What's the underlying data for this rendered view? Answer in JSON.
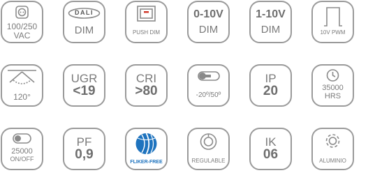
{
  "tiles": [
    {
      "id": "power",
      "icon": "power-socket-icon",
      "lines": [
        "100/250",
        "VAC"
      ]
    },
    {
      "id": "dali",
      "icon": "dali-icon",
      "logo": "DALI",
      "lines": [
        "DIM"
      ]
    },
    {
      "id": "push",
      "icon": "push-switch-icon",
      "lines": [
        "PUSH DIM"
      ]
    },
    {
      "id": "v010",
      "lines": [
        "0-10V",
        "DIM"
      ]
    },
    {
      "id": "v110",
      "lines": [
        "1-10V",
        "DIM"
      ]
    },
    {
      "id": "pwm",
      "icon": "pwm-wave-icon",
      "lines": [
        "10V PWM"
      ]
    },
    {
      "id": "beam",
      "icon": "beam-angle-icon",
      "lines": [
        "120°"
      ]
    },
    {
      "id": "ugr",
      "lines": [
        "UGR",
        "<19"
      ]
    },
    {
      "id": "cri",
      "lines": [
        "CRI",
        ">80"
      ]
    },
    {
      "id": "temp",
      "icon": "thermometer-icon",
      "lines": [
        "-20º/50º"
      ]
    },
    {
      "id": "ip",
      "lines": [
        "IP",
        "20"
      ]
    },
    {
      "id": "hrs",
      "icon": "clock-icon",
      "lines": [
        "35000",
        "HRS"
      ]
    },
    {
      "id": "onoff",
      "icon": "toggle-switch-icon",
      "lines": [
        "25000",
        "ON/OFF"
      ]
    },
    {
      "id": "pf",
      "lines": [
        "PF",
        "0,9"
      ]
    },
    {
      "id": "flicker",
      "icon": "flicker-free-globe-icon",
      "lines": [
        "FLIKER-FREE"
      ],
      "accent": "#1e73be"
    },
    {
      "id": "dim",
      "icon": "dimmer-knob-icon",
      "lines": [
        "REGULABLE"
      ]
    },
    {
      "id": "ik",
      "lines": [
        "IK",
        "06"
      ]
    },
    {
      "id": "alu",
      "icon": "gear-icon",
      "lines": [
        "ALUMINIO"
      ]
    }
  ]
}
